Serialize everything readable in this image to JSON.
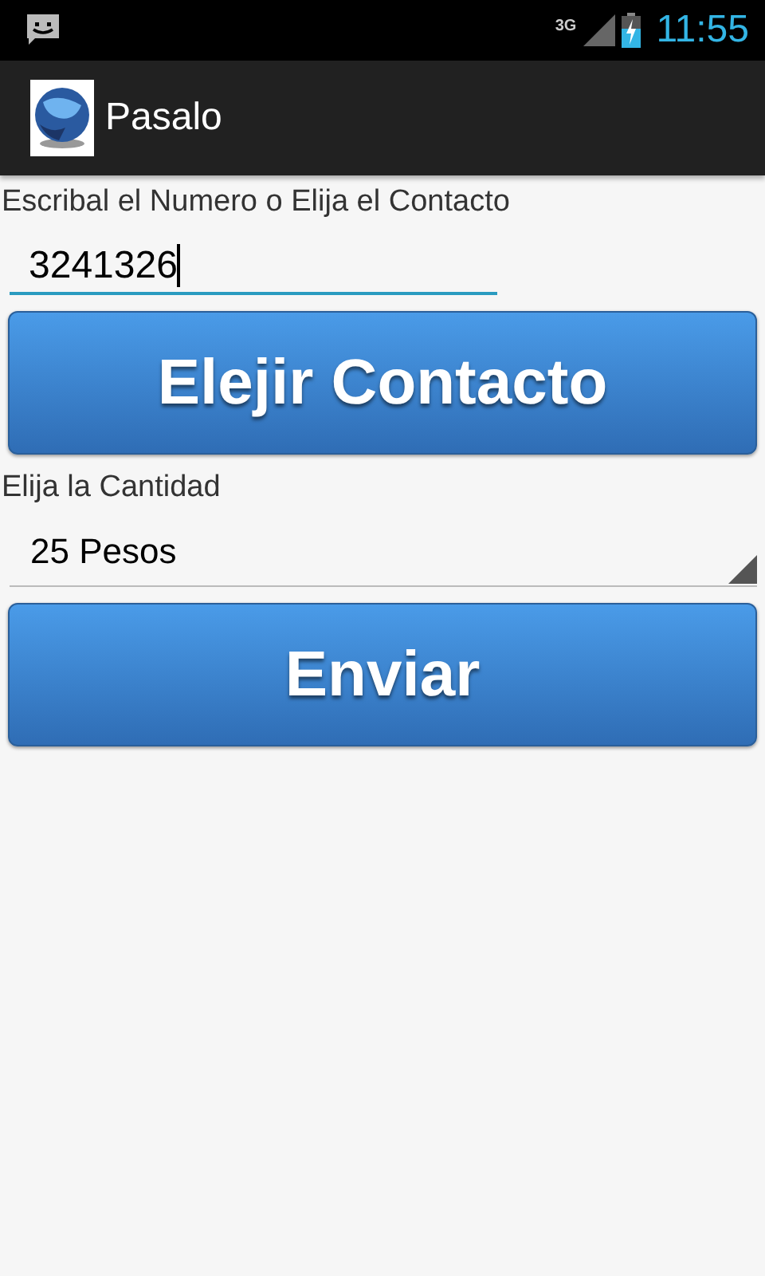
{
  "status_bar": {
    "network": "3G",
    "time": "11:55"
  },
  "app_bar": {
    "title": "Pasalo"
  },
  "number_label": "Escribal el Numero o Elija el Contacto",
  "number_field": {
    "value": "3241326",
    "focused": true
  },
  "contact_button": "Elejir Contacto",
  "amount_label": "Elija la Cantidad",
  "amount_dropdown": {
    "value": "25 Pesos"
  },
  "send_button": "Enviar"
}
